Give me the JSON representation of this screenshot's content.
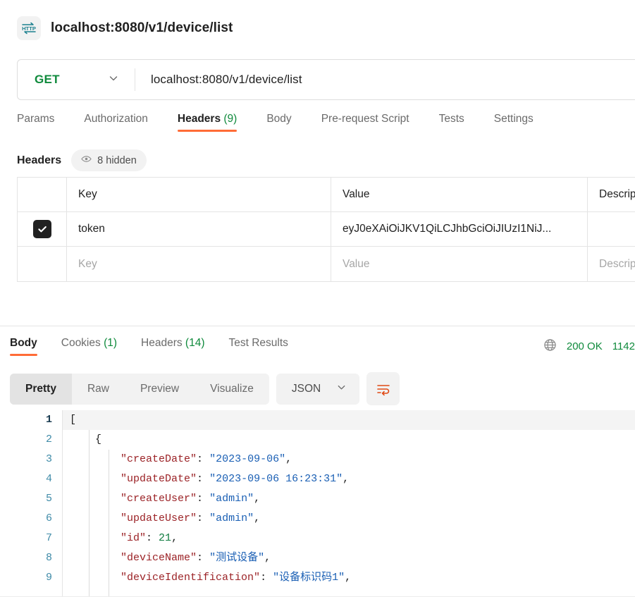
{
  "request": {
    "icon": "http-protocol-icon",
    "title": "localhost:8080/v1/device/list",
    "method": "GET",
    "url": "localhost:8080/v1/device/list",
    "tabs": [
      {
        "label": "Params",
        "count": "",
        "active": false
      },
      {
        "label": "Authorization",
        "count": "",
        "active": false
      },
      {
        "label": "Headers",
        "count": "(9)",
        "active": true
      },
      {
        "label": "Body",
        "count": "",
        "active": false
      },
      {
        "label": "Pre-request Script",
        "count": "",
        "active": false
      },
      {
        "label": "Tests",
        "count": "",
        "active": false
      },
      {
        "label": "Settings",
        "count": "",
        "active": false
      }
    ],
    "headers_section": {
      "title": "Headers",
      "hidden_badge": "8 hidden",
      "hidden_icon": "eye-icon",
      "columns": [
        "Key",
        "Value",
        "Description"
      ],
      "rows": [
        {
          "checked": true,
          "key": "token",
          "value": "eyJ0eXAiOiJKV1QiLCJhbGciOiJIUzI1NiJ...",
          "description": ""
        }
      ],
      "placeholder_row": {
        "key": "Key",
        "value": "Value",
        "description": "Description"
      }
    }
  },
  "response": {
    "tabs": [
      {
        "label": "Body",
        "count": "",
        "active": true
      },
      {
        "label": "Cookies",
        "count": "(1)",
        "active": false
      },
      {
        "label": "Headers",
        "count": "(14)",
        "active": false
      },
      {
        "label": "Test Results",
        "count": "",
        "active": false
      }
    ],
    "status_icon": "globe-icon",
    "status": "200 OK",
    "time": "1142",
    "view_modes": [
      {
        "label": "Pretty",
        "active": true
      },
      {
        "label": "Raw",
        "active": false
      },
      {
        "label": "Preview",
        "active": false
      },
      {
        "label": "Visualize",
        "active": false
      }
    ],
    "format": "JSON",
    "wrap_icon": "word-wrap-icon",
    "code": {
      "active_line": 1,
      "lines": [
        {
          "n": "1",
          "tokens": [
            {
              "t": "[",
              "c": "p"
            }
          ],
          "indent": 0
        },
        {
          "n": "2",
          "tokens": [
            {
              "t": "{",
              "c": "p"
            }
          ],
          "indent": 1
        },
        {
          "n": "3",
          "tokens": [
            {
              "t": "\"createDate\"",
              "c": "k"
            },
            {
              "t": ": ",
              "c": "p"
            },
            {
              "t": "\"2023-09-06\"",
              "c": "s"
            },
            {
              "t": ",",
              "c": "p"
            }
          ],
          "indent": 2
        },
        {
          "n": "4",
          "tokens": [
            {
              "t": "\"updateDate\"",
              "c": "k"
            },
            {
              "t": ": ",
              "c": "p"
            },
            {
              "t": "\"2023-09-06 16:23:31\"",
              "c": "s"
            },
            {
              "t": ",",
              "c": "p"
            }
          ],
          "indent": 2
        },
        {
          "n": "5",
          "tokens": [
            {
              "t": "\"createUser\"",
              "c": "k"
            },
            {
              "t": ": ",
              "c": "p"
            },
            {
              "t": "\"admin\"",
              "c": "s"
            },
            {
              "t": ",",
              "c": "p"
            }
          ],
          "indent": 2
        },
        {
          "n": "6",
          "tokens": [
            {
              "t": "\"updateUser\"",
              "c": "k"
            },
            {
              "t": ": ",
              "c": "p"
            },
            {
              "t": "\"admin\"",
              "c": "s"
            },
            {
              "t": ",",
              "c": "p"
            }
          ],
          "indent": 2
        },
        {
          "n": "7",
          "tokens": [
            {
              "t": "\"id\"",
              "c": "k"
            },
            {
              "t": ": ",
              "c": "p"
            },
            {
              "t": "21",
              "c": "n"
            },
            {
              "t": ",",
              "c": "p"
            }
          ],
          "indent": 2
        },
        {
          "n": "8",
          "tokens": [
            {
              "t": "\"deviceName\"",
              "c": "k"
            },
            {
              "t": ": ",
              "c": "p"
            },
            {
              "t": "\"测试设备\"",
              "c": "s"
            },
            {
              "t": ",",
              "c": "p"
            }
          ],
          "indent": 2
        },
        {
          "n": "9",
          "tokens": [
            {
              "t": "\"deviceIdentification\"",
              "c": "k"
            },
            {
              "t": ": ",
              "c": "p"
            },
            {
              "t": "\"设备标识码1\"",
              "c": "s"
            },
            {
              "t": ",",
              "c": "p"
            }
          ],
          "indent": 2
        }
      ]
    }
  },
  "colors": {
    "accent": "#ff6c37",
    "success": "#0f8a3c",
    "key": "#9b2226",
    "string": "#1a5fb4",
    "number": "#0f7b3f",
    "icon_teal": "#1a7f8e"
  }
}
